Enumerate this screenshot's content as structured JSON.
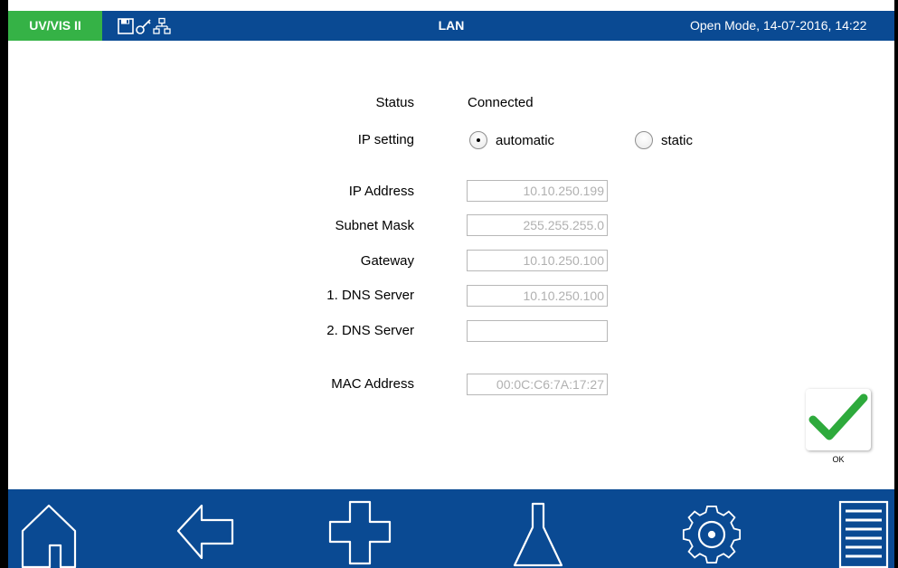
{
  "header": {
    "app_badge": "UV/VIS II",
    "title": "LAN",
    "status": "Open Mode, 14-07-2016, 14:22",
    "icons": [
      "save-icon",
      "key-icon",
      "network-icon"
    ]
  },
  "form": {
    "status_label": "Status",
    "status_value": "Connected",
    "ip_setting_label": "IP setting",
    "ip_setting_options": [
      {
        "label": "automatic",
        "selected": true
      },
      {
        "label": "static",
        "selected": false
      }
    ],
    "ip_address_label": "IP Address",
    "ip_address_value": "10.10.250.199",
    "subnet_mask_label": "Subnet Mask",
    "subnet_mask_value": "255.255.255.0",
    "gateway_label": "Gateway",
    "gateway_value": "10.10.250.100",
    "dns1_label": "1. DNS Server",
    "dns1_value": "10.10.250.100",
    "dns2_label": "2. DNS Server",
    "dns2_value": "",
    "mac_label": "MAC Address",
    "mac_value": "00:0C:C6:7A:17:27"
  },
  "ok_button": {
    "label": "OK",
    "icon": "checkmark-icon",
    "color": "#2eaa3c"
  },
  "footer": {
    "buttons": [
      "home-icon",
      "back-arrow-icon",
      "plus-icon",
      "flask-icon",
      "gear-icon",
      "menu-list-icon"
    ]
  },
  "colors": {
    "header_bg": "#0a4a93",
    "badge_bg": "#35b246",
    "footer_bg": "#0a4a93"
  }
}
